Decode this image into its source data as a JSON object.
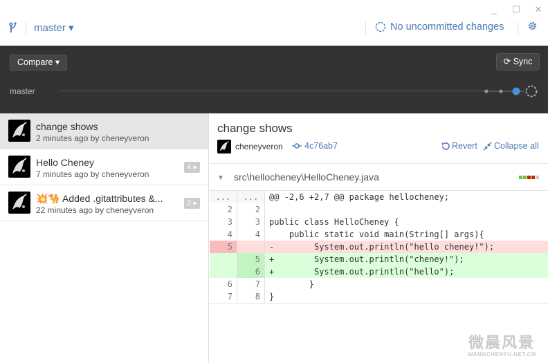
{
  "window": {
    "minimize": "_",
    "maximize": "☐",
    "close": "✕"
  },
  "topbar": {
    "branch": "master ▾",
    "status": "No uncommitted changes"
  },
  "header": {
    "compare": "Compare ▾",
    "sync": "Sync",
    "branch_label": "master"
  },
  "commits": [
    {
      "title": "change shows",
      "meta": "2 minutes ago by cheneyveron",
      "count": ""
    },
    {
      "title": "Hello Cheney",
      "meta": "7 minutes ago by cheneyveron",
      "count": "4 ▸"
    },
    {
      "title": "💥🐪 Added .gitattributes &...",
      "meta": "22 minutes ago by cheneyveron",
      "count": "2 ▸"
    }
  ],
  "detail": {
    "title": "change shows",
    "author": "cheneyveron",
    "sha": "4c76ab7",
    "revert": "Revert",
    "collapse": "Collapse all"
  },
  "file": {
    "path": "src\\hellocheney\\HelloCheney.java",
    "diffstat_colors": [
      "#6cc644",
      "#6cc644",
      "#bd2c00",
      "#bd2c00",
      "#ccc"
    ]
  },
  "diff": [
    {
      "type": "hunk",
      "old": "...",
      "new": "...",
      "code": "@@ -2,6 +2,7 @@ package hellocheney;"
    },
    {
      "type": "ctx",
      "old": "2",
      "new": "2",
      "code": ""
    },
    {
      "type": "ctx",
      "old": "3",
      "new": "3",
      "code": "public class HelloCheney {"
    },
    {
      "type": "ctx",
      "old": "4",
      "new": "4",
      "code": "    public static void main(String[] args){"
    },
    {
      "type": "del",
      "old": "5",
      "new": "",
      "code": "-        System.out.println(\"hello cheney!\");"
    },
    {
      "type": "add",
      "old": "",
      "new": "5",
      "code": "+        System.out.println(\"cheney!\");"
    },
    {
      "type": "add",
      "old": "",
      "new": "6",
      "code": "+        System.out.println(\"hello\");"
    },
    {
      "type": "ctx",
      "old": "6",
      "new": "7",
      "code": "        }"
    },
    {
      "type": "ctx",
      "old": "7",
      "new": "8",
      "code": "}"
    }
  ],
  "watermark": {
    "main": "微晨风景",
    "sub": "WANGCHENYU.NET.CN"
  },
  "colors": {
    "accent": "#4a78b5",
    "header_bg": "#333333",
    "del_bg": "#ffdddd",
    "add_bg": "#dbffdb"
  }
}
